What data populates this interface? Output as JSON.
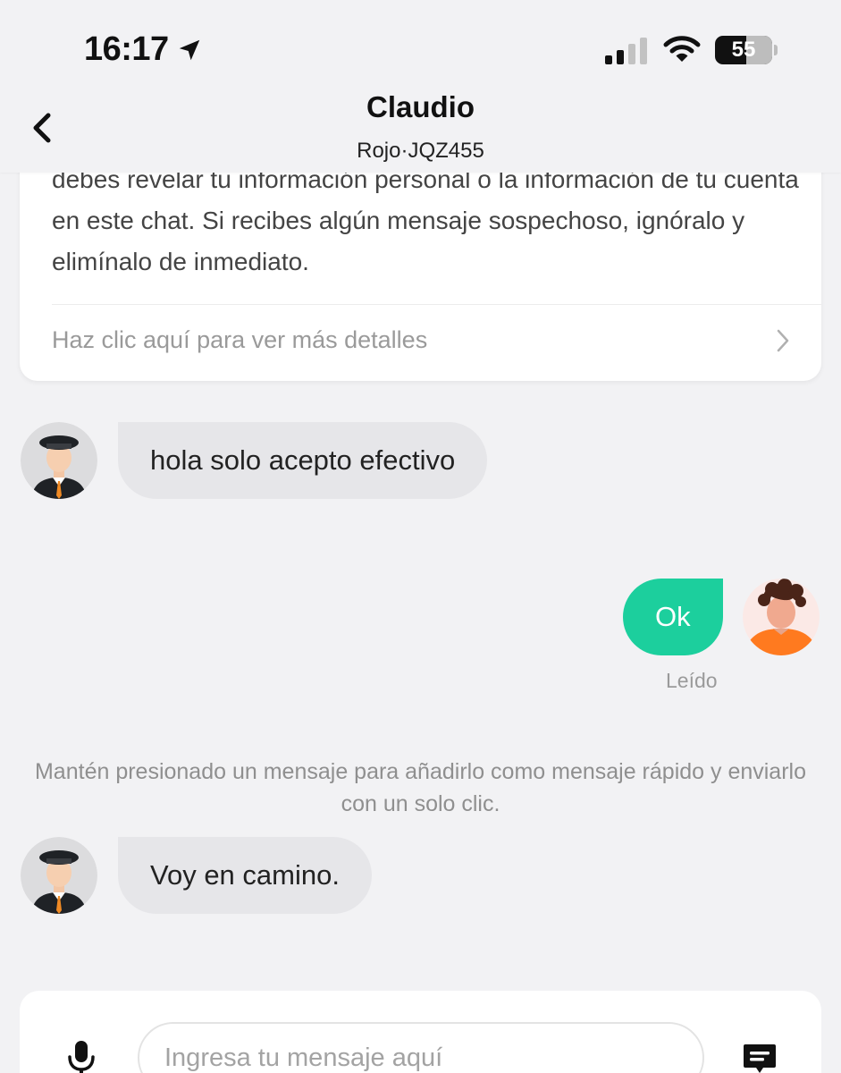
{
  "status_bar": {
    "time": "16:17",
    "battery_level": "55",
    "icons": [
      "location-arrow-icon",
      "signal-icon",
      "wifi-icon",
      "battery-icon"
    ]
  },
  "header": {
    "contact_name": "Claudio",
    "vehicle_info": "Rojo·JQZ455",
    "back_icon": "back-arrow-icon"
  },
  "safety_notice": {
    "text": "debes revelar tu información personal o la información de tu cuenta en este chat. Si recibes algún mensaje sospechoso, ignóralo y elimínalo de inmediato.",
    "details_link": "Haz clic aquí para ver más detalles"
  },
  "messages": [
    {
      "from": "driver",
      "text": "hola solo acepto efectivo"
    },
    {
      "from": "user",
      "text": "Ok",
      "status": "Leído"
    },
    {
      "from": "driver",
      "text": "Voy en camino."
    }
  ],
  "tip": "Mantén presionado un mensaje para añadirlo como mensaje rápido y enviarlo con un solo clic.",
  "input": {
    "placeholder": "Ingresa tu mensaje aquí",
    "value": ""
  },
  "colors": {
    "accent": "#1ccf9d",
    "background": "#f2f2f4",
    "incoming_bubble": "#e6e6e9"
  }
}
